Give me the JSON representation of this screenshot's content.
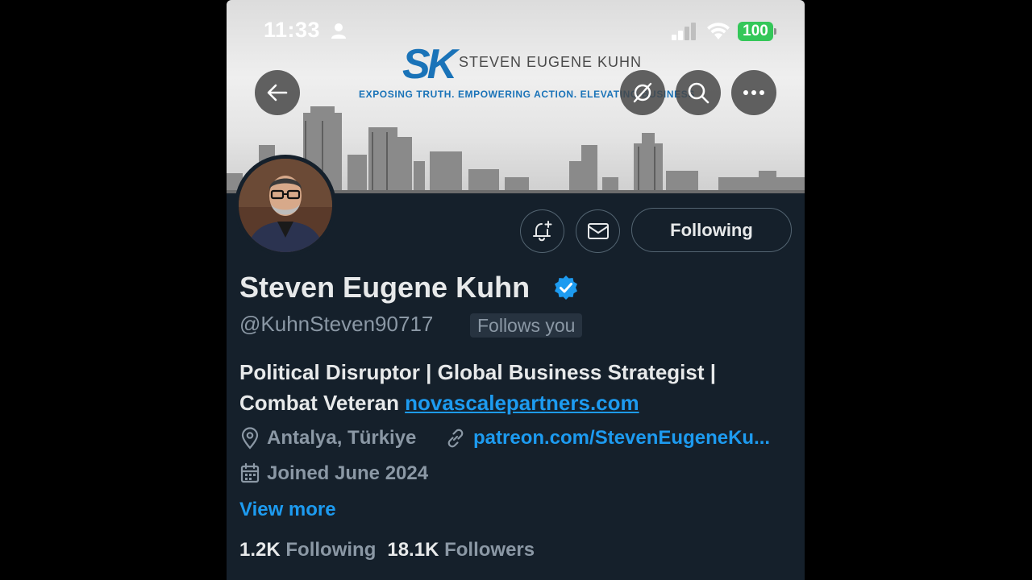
{
  "status_bar": {
    "time": "11:33",
    "battery": "100",
    "battery_color": "#34c759"
  },
  "banner": {
    "logo_mark": "SK",
    "logo_name": "STEVEN EUGENE KUHN",
    "tagline": "EXPOSING TRUTH. EMPOWERING ACTION. ELEVATING BUSINESS",
    "brand_color": "#1a73b8"
  },
  "header_buttons": {
    "back": "arrow-left-icon",
    "grok": "grok-icon",
    "search": "search-icon",
    "more": "more-horizontal-icon"
  },
  "profile": {
    "name": "Steven Eugene Kuhn",
    "handle": "@KuhnSteven90717",
    "follows_you": "Follows you",
    "verified_color": "#1d9bf0",
    "bio_text": "Political Disruptor | Global Business Strategist | Combat Veteran ",
    "bio_link": "novascalepartners.com",
    "location": "Antalya, Türkiye",
    "website": "patreon.com/StevenEugeneKu...",
    "joined": "Joined June 2024",
    "view_more": "View more"
  },
  "actions": {
    "notify_icon": "bell-plus-icon",
    "message_icon": "mail-icon",
    "following_label": "Following"
  },
  "stats": {
    "following_count": "1.2K",
    "following_label": "Following",
    "followers_count": "18.1K",
    "followers_label": "Followers"
  },
  "colors": {
    "background": "#15202b",
    "link": "#1d9bf0",
    "muted": "#8b98a5",
    "text": "#e7e9ea"
  }
}
